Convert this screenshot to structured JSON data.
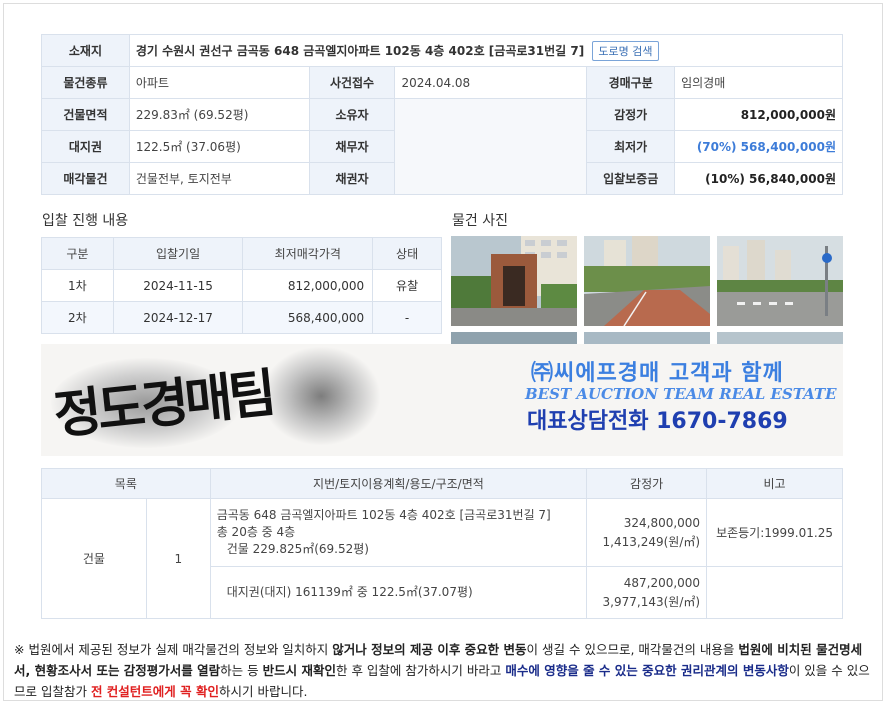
{
  "property": {
    "address_label": "소재지",
    "address": "경기 수원시 권선구 금곡동 648 금곡엘지아파트 102동 4층 402호 [금곡로31번길 7]",
    "road_search_button": "도로명 검색",
    "type_label": "물건종류",
    "type": "아파트",
    "case_label": "사건접수",
    "case_date": "2024.04.08",
    "auction_type_label": "경매구분",
    "auction_type": "임의경매",
    "building_area_label": "건물면적",
    "building_area": "229.83㎡ (69.52평)",
    "owner_label": "소유자",
    "appraisal_label": "감정가",
    "appraisal": "812,000,000원",
    "land_right_label": "대지권",
    "land_right": "122.5㎡ (37.06평)",
    "debtor_label": "채무자",
    "min_price_label": "최저가",
    "min_price": "(70%) 568,400,000원",
    "sale_scope_label": "매각물건",
    "sale_scope": "건물전부, 토지전부",
    "creditor_label": "채권자",
    "deposit_label": "입찰보증금",
    "deposit": "(10%) 56,840,000원"
  },
  "bidding": {
    "title": "입찰 진행 내용",
    "headers": [
      "구분",
      "입찰기일",
      "최저매각가격",
      "상태"
    ],
    "rows": [
      {
        "round": "1차",
        "date": "2024-11-15",
        "price": "812,000,000",
        "status": "유찰"
      },
      {
        "round": "2차",
        "date": "2024-12-17",
        "price": "568,400,000",
        "status": "-"
      }
    ]
  },
  "photos": {
    "title": "물건 사진"
  },
  "banner": {
    "calligraphy": "정도경매팀",
    "line1": "㈜씨에프경매  고객과 함께",
    "line2": "BEST AUCTION TEAM   REAL ESTATE",
    "line3": "대표상담전화 1670-7869"
  },
  "detail": {
    "headers": [
      "목록",
      "지번/토지이용계획/용도/구조/면적",
      "감정가",
      "비고"
    ],
    "category": "건물",
    "index": "1",
    "building_desc_1": "금곡동 648 금곡엘지아파트 102동 4층 402호 [금곡로31번길 7]",
    "building_desc_2": "총 20층 중 4층",
    "building_desc_3": "건물 229.825㎡(69.52평)",
    "building_price": "324,800,000",
    "building_unit": "1,413,249(원/㎡)",
    "building_note": "보존등기:1999.01.25",
    "land_desc": "대지권(대지) 161139㎡ 중 122.5㎡(37.07평)",
    "land_price": "487,200,000",
    "land_unit": "3,977,143(원/㎡)"
  },
  "notice": {
    "p1": "※ 법원에서 제공된 정보가 실제 매각물건의 정보와 일치하지 ",
    "b1": "않거나 정보의 제공 이후 중요한 변동",
    "p2": "이 생길 수 있으므로, 매각물건의 내용을 ",
    "b2": "법원에 비치된 물건명세서, 현황조사서 또는 감정평가서를 열람",
    "p3": "하는 등 ",
    "b3": "반드시 재확인",
    "p4": "한 후 입찰에 참가하시기 바라고 ",
    "n1": "매수에 영향을 줄 수 있는 중요한 권리관계의 변동사항",
    "p5": "이 있을 수 있으므로 입찰참가 ",
    "r1": "전 컨설턴트에게 꼭 확인",
    "p6": "하시기 바랍니다."
  }
}
